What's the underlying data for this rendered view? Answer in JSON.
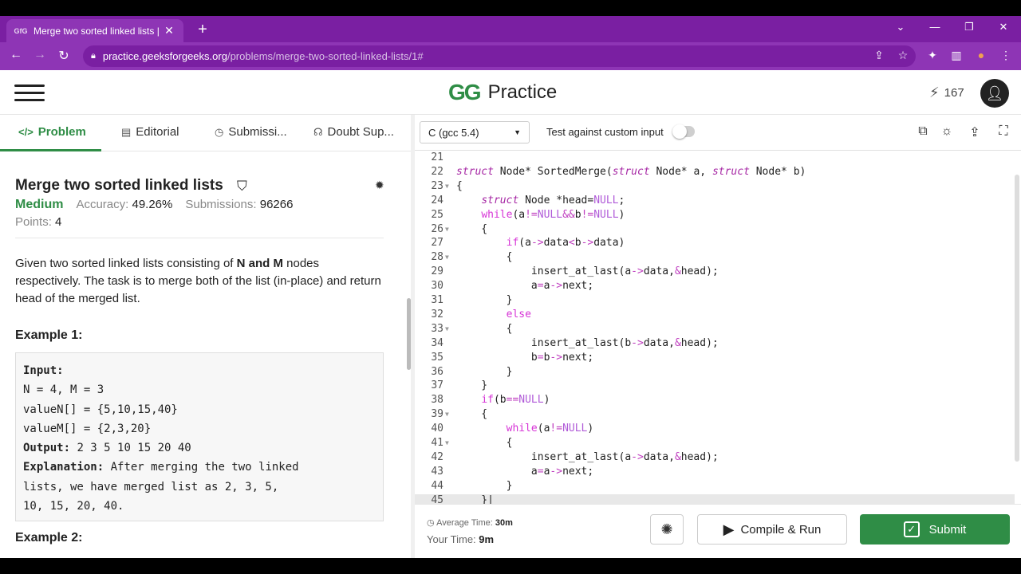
{
  "browser": {
    "tab_title": "Merge two sorted linked lists | Pr",
    "favicon": "GfG",
    "url_host": "practice.geeksforgeeks.org",
    "url_path": "/problems/merge-two-sorted-linked-lists/1#"
  },
  "header": {
    "logo_mark": "GG",
    "logo_word": "Practice",
    "streak": "167"
  },
  "problem_tabs": [
    "Problem",
    "Editorial",
    "Submissi...",
    "Doubt Sup..."
  ],
  "problem": {
    "title": "Merge two sorted linked lists",
    "difficulty": "Medium",
    "accuracy_label": "Accuracy:",
    "accuracy": "49.26%",
    "submissions_label": "Submissions:",
    "submissions": "96266",
    "points_label": "Points:",
    "points": "4",
    "desc_1": "Given two sorted linked lists consisting of ",
    "desc_bold": "N and M",
    "desc_2": " nodes respectively. The task is to merge both of the list (in-place) and return head of the merged list.",
    "example1_title": "Example 1:",
    "example1": {
      "input_label": "Input:",
      "line1": "N = 4, M = 3",
      "line2": "valueN[] = {5,10,15,40}",
      "line3": "valueM[] = {2,3,20}",
      "output_label": "Output:",
      "output": " 2 3 5 10 15 20 40",
      "explanation_label": "Explanation:",
      "explanation_1": " After merging the two linked",
      "explanation_2": "lists, we have merged list as 2, 3, 5,",
      "explanation_3": "10, 15, 20, 40."
    },
    "example2_title": "Example 2:"
  },
  "editor": {
    "language": "C (gcc 5.4)",
    "test_label": "Test against custom input",
    "code": [
      {
        "n": "21",
        "fold": false,
        "html": ""
      },
      {
        "n": "22",
        "fold": false,
        "html": "<span class='kw'>struct</span> Node* SortedMerge(<span class='kw'>struct</span> Node* a, <span class='kw'>struct</span> Node* b)"
      },
      {
        "n": "23",
        "fold": true,
        "html": "{"
      },
      {
        "n": "24",
        "fold": false,
        "html": "    <span class='kw'>struct</span> Node *head=<span class='nul'>NULL</span>;"
      },
      {
        "n": "25",
        "fold": false,
        "html": "    <span class='ctl'>while</span>(a<span class='op'>!=</span><span class='nul'>NULL</span><span class='op'>&amp;&amp;</span>b<span class='op'>!=</span><span class='nul'>NULL</span>)"
      },
      {
        "n": "26",
        "fold": true,
        "html": "    {"
      },
      {
        "n": "27",
        "fold": false,
        "html": "        <span class='ctl'>if</span>(a<span class='op'>-&gt;</span>data<span class='op'>&lt;</span>b<span class='op'>-&gt;</span>data)"
      },
      {
        "n": "28",
        "fold": true,
        "html": "        {"
      },
      {
        "n": "29",
        "fold": false,
        "html": "            insert_at_last(a<span class='op'>-&gt;</span>data,<span class='op'>&amp;</span>head);"
      },
      {
        "n": "30",
        "fold": false,
        "html": "            a<span class='op'>=</span>a<span class='op'>-&gt;</span>next;"
      },
      {
        "n": "31",
        "fold": false,
        "html": "        }"
      },
      {
        "n": "32",
        "fold": false,
        "html": "        <span class='ctl'>else</span>"
      },
      {
        "n": "33",
        "fold": true,
        "html": "        {"
      },
      {
        "n": "34",
        "fold": false,
        "html": "            insert_at_last(b<span class='op'>-&gt;</span>data,<span class='op'>&amp;</span>head);"
      },
      {
        "n": "35",
        "fold": false,
        "html": "            b<span class='op'>=</span>b<span class='op'>-&gt;</span>next;"
      },
      {
        "n": "36",
        "fold": false,
        "html": "        }"
      },
      {
        "n": "37",
        "fold": false,
        "html": "    }"
      },
      {
        "n": "38",
        "fold": false,
        "html": "    <span class='ctl'>if</span>(b<span class='op'>==</span><span class='nul'>NULL</span>)"
      },
      {
        "n": "39",
        "fold": true,
        "html": "    {"
      },
      {
        "n": "40",
        "fold": false,
        "html": "        <span class='ctl'>while</span>(a<span class='op'>!=</span><span class='nul'>NULL</span>)"
      },
      {
        "n": "41",
        "fold": true,
        "html": "        {"
      },
      {
        "n": "42",
        "fold": false,
        "html": "            insert_at_last(a<span class='op'>-&gt;</span>data,<span class='op'>&amp;</span>head);"
      },
      {
        "n": "43",
        "fold": false,
        "html": "            a<span class='op'>=</span>a<span class='op'>-&gt;</span>next;"
      },
      {
        "n": "44",
        "fold": false,
        "html": "        }"
      },
      {
        "n": "45",
        "fold": false,
        "html": "    }|"
      }
    ]
  },
  "footer": {
    "avg_label": "Average Time: ",
    "avg_time": "30m",
    "your_label": "Your Time: ",
    "your_time": "9m",
    "compile_label": "Compile & Run",
    "submit_label": "Submit"
  },
  "colors": {
    "brand_green": "#2f8d46",
    "browser_purple": "#7a1fa2"
  }
}
